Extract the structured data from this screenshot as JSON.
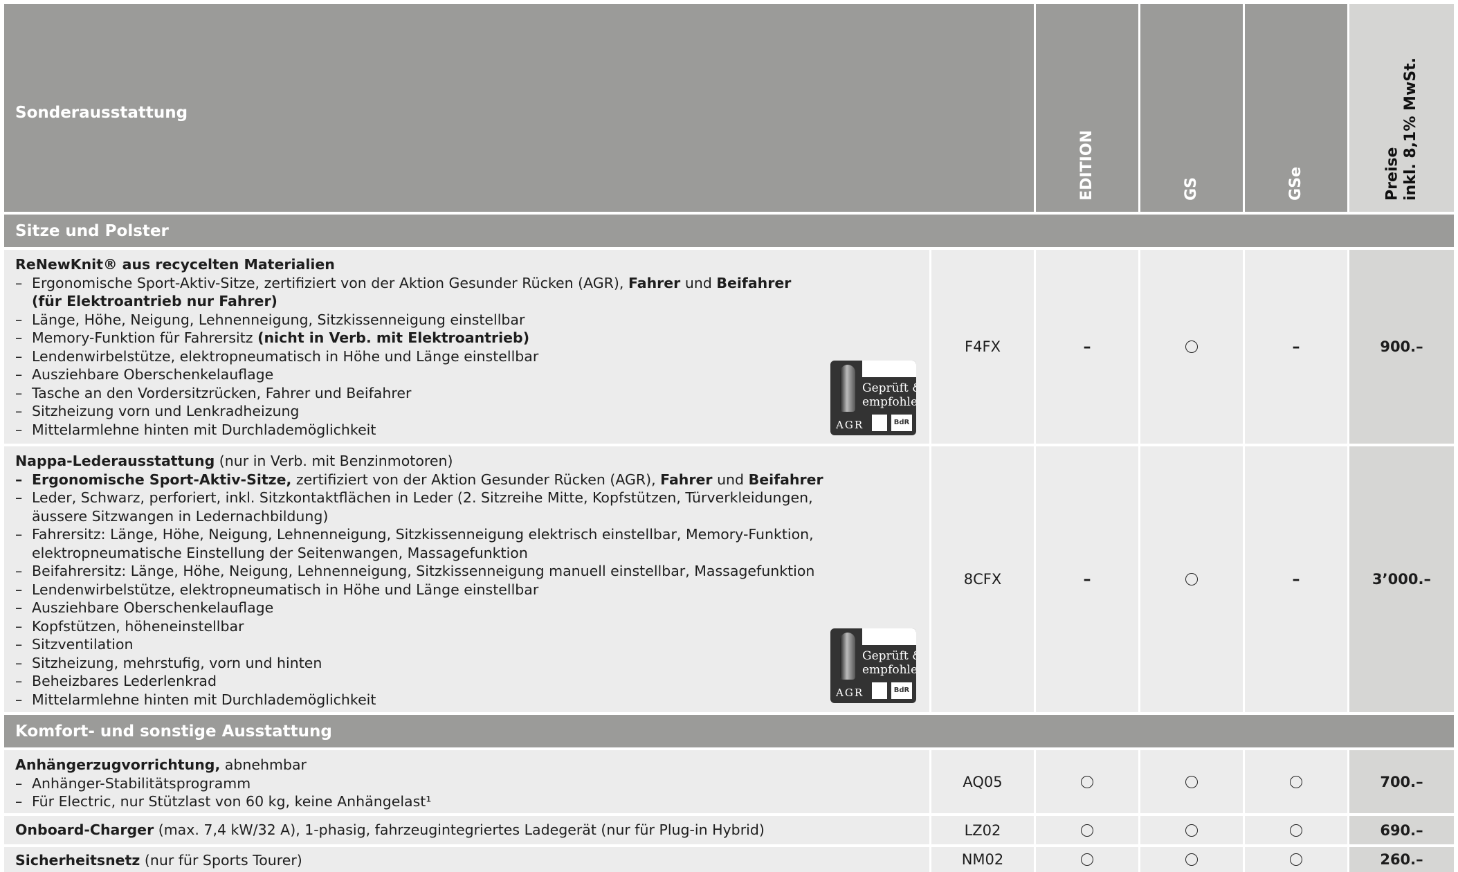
{
  "header": {
    "title": "Sonderausstattung",
    "col_edition": "EDITION",
    "col_gs": "GS",
    "col_gse": "GSe",
    "col_price_line1": "Preise",
    "col_price_line2": "inkl. 8,1% MwSt."
  },
  "sections": {
    "seats": "Sitze und Polster",
    "comfort": "Komfort- und sonstige Ausstattung"
  },
  "badge": {
    "line1": "Geprüft &",
    "line2": "empfohlen",
    "agr": "AGR",
    "bdr": "BdR"
  },
  "rows": {
    "renewknit": {
      "title": "ReNewKnit® aus recycelten Materialien",
      "b1_text": "Ergonomische Sport-Aktiv-Sitze, zertifiziert von der Aktion Gesunder Rücken (AGR),",
      "b1_bold1": "Fahrer",
      "b1_and": "und",
      "b1_bold2": "Beifahrer",
      "b1_bold3": "(für Elektroantrieb nur Fahrer)",
      "b2": "Länge, Höhe, Neigung, Lehnenneigung, Sitzkissenneigung einstellbar",
      "b3_text": "Memory-Funktion für Fahrersitz",
      "b3_bold": "(nicht in Verb. mit Elektroantrieb)",
      "b4": "Lendenwirbelstütze, elektropneumatisch in Höhe und Länge einstellbar",
      "b5": "Ausziehbare Oberschenkelauflage",
      "b6": "Tasche an den Vordersitzrücken, Fahrer und Beifahrer",
      "b7": "Sitzheizung vorn und Lenkradheizung",
      "b8": "Mittelarmlehne hinten mit Durchlademöglichkeit",
      "code": "F4FX",
      "edition": "–",
      "gs": "circle",
      "gse": "–",
      "price": "900.–"
    },
    "nappa": {
      "title": "Nappa-Lederausstattung",
      "title_note": "(nur in Verb. mit Benzinmotoren)",
      "b1_bold": "Ergonomische Sport-Aktiv-Sitze,",
      "b1_text": "zertifiziert von der Aktion Gesunder Rücken (AGR),",
      "b1_bold2": "Fahrer",
      "b1_and": "und",
      "b1_bold3": "Beifahrer",
      "b2_l1": "Leder, Schwarz, perforiert, inkl. Sitzkontaktflächen in Leder (2. Sitzreihe Mitte, Kopfstützen, Türverkleidungen,",
      "b2_l2": "äussere Sitzwangen in Ledernachbildung)",
      "b3_l1": "Fahrersitz: Länge, Höhe, Neigung, Lehnenneigung, Sitzkissenneigung elektrisch einstellbar, Memory-Funktion,",
      "b3_l2": "elektropneumatische Einstellung der Seitenwangen, Massagefunktion",
      "b4": "Beifahrersitz: Länge, Höhe, Neigung, Lehnenneigung, Sitzkissenneigung manuell einstellbar, Massagefunktion",
      "b5": "Lendenwirbelstütze, elektropneumatisch in Höhe und Länge einstellbar",
      "b6": "Ausziehbare Oberschenkelauflage",
      "b7": "Kopfstützen, höheneinstellbar",
      "b8": "Sitzventilation",
      "b9": "Sitzheizung, mehrstufig, vorn und hinten",
      "b10": "Beheizbares Lederlenkrad",
      "b11": "Mittelarmlehne hinten mit Durchlademöglichkeit",
      "code": "8CFX",
      "edition": "–",
      "gs": "circle",
      "gse": "–",
      "price": "3’000.–"
    },
    "towbar": {
      "title": "Anhängerzugvorrichtung,",
      "title_note": "abnehmbar",
      "b1": "Anhänger-Stabilitätsprogramm",
      "b2": "Für Electric, nur Stützlast von 60 kg, keine Anhängelast¹",
      "code": "AQ05",
      "edition": "circle",
      "gs": "circle",
      "gse": "circle",
      "price": "700.–"
    },
    "charger": {
      "title": "Onboard-Charger",
      "title_note": "(max. 7,4 kW/32 A), 1-phasig, fahrzeugintegriertes Ladegerät (nur für Plug-in Hybrid)",
      "code": "LZ02",
      "edition": "circle",
      "gs": "circle",
      "gse": "circle",
      "price": "690.–"
    },
    "net": {
      "title": "Sicherheitsnetz",
      "title_note": "(nur für Sports Tourer)",
      "code": "NM02",
      "edition": "circle",
      "gs": "circle",
      "gse": "circle",
      "price": "260.–"
    }
  }
}
